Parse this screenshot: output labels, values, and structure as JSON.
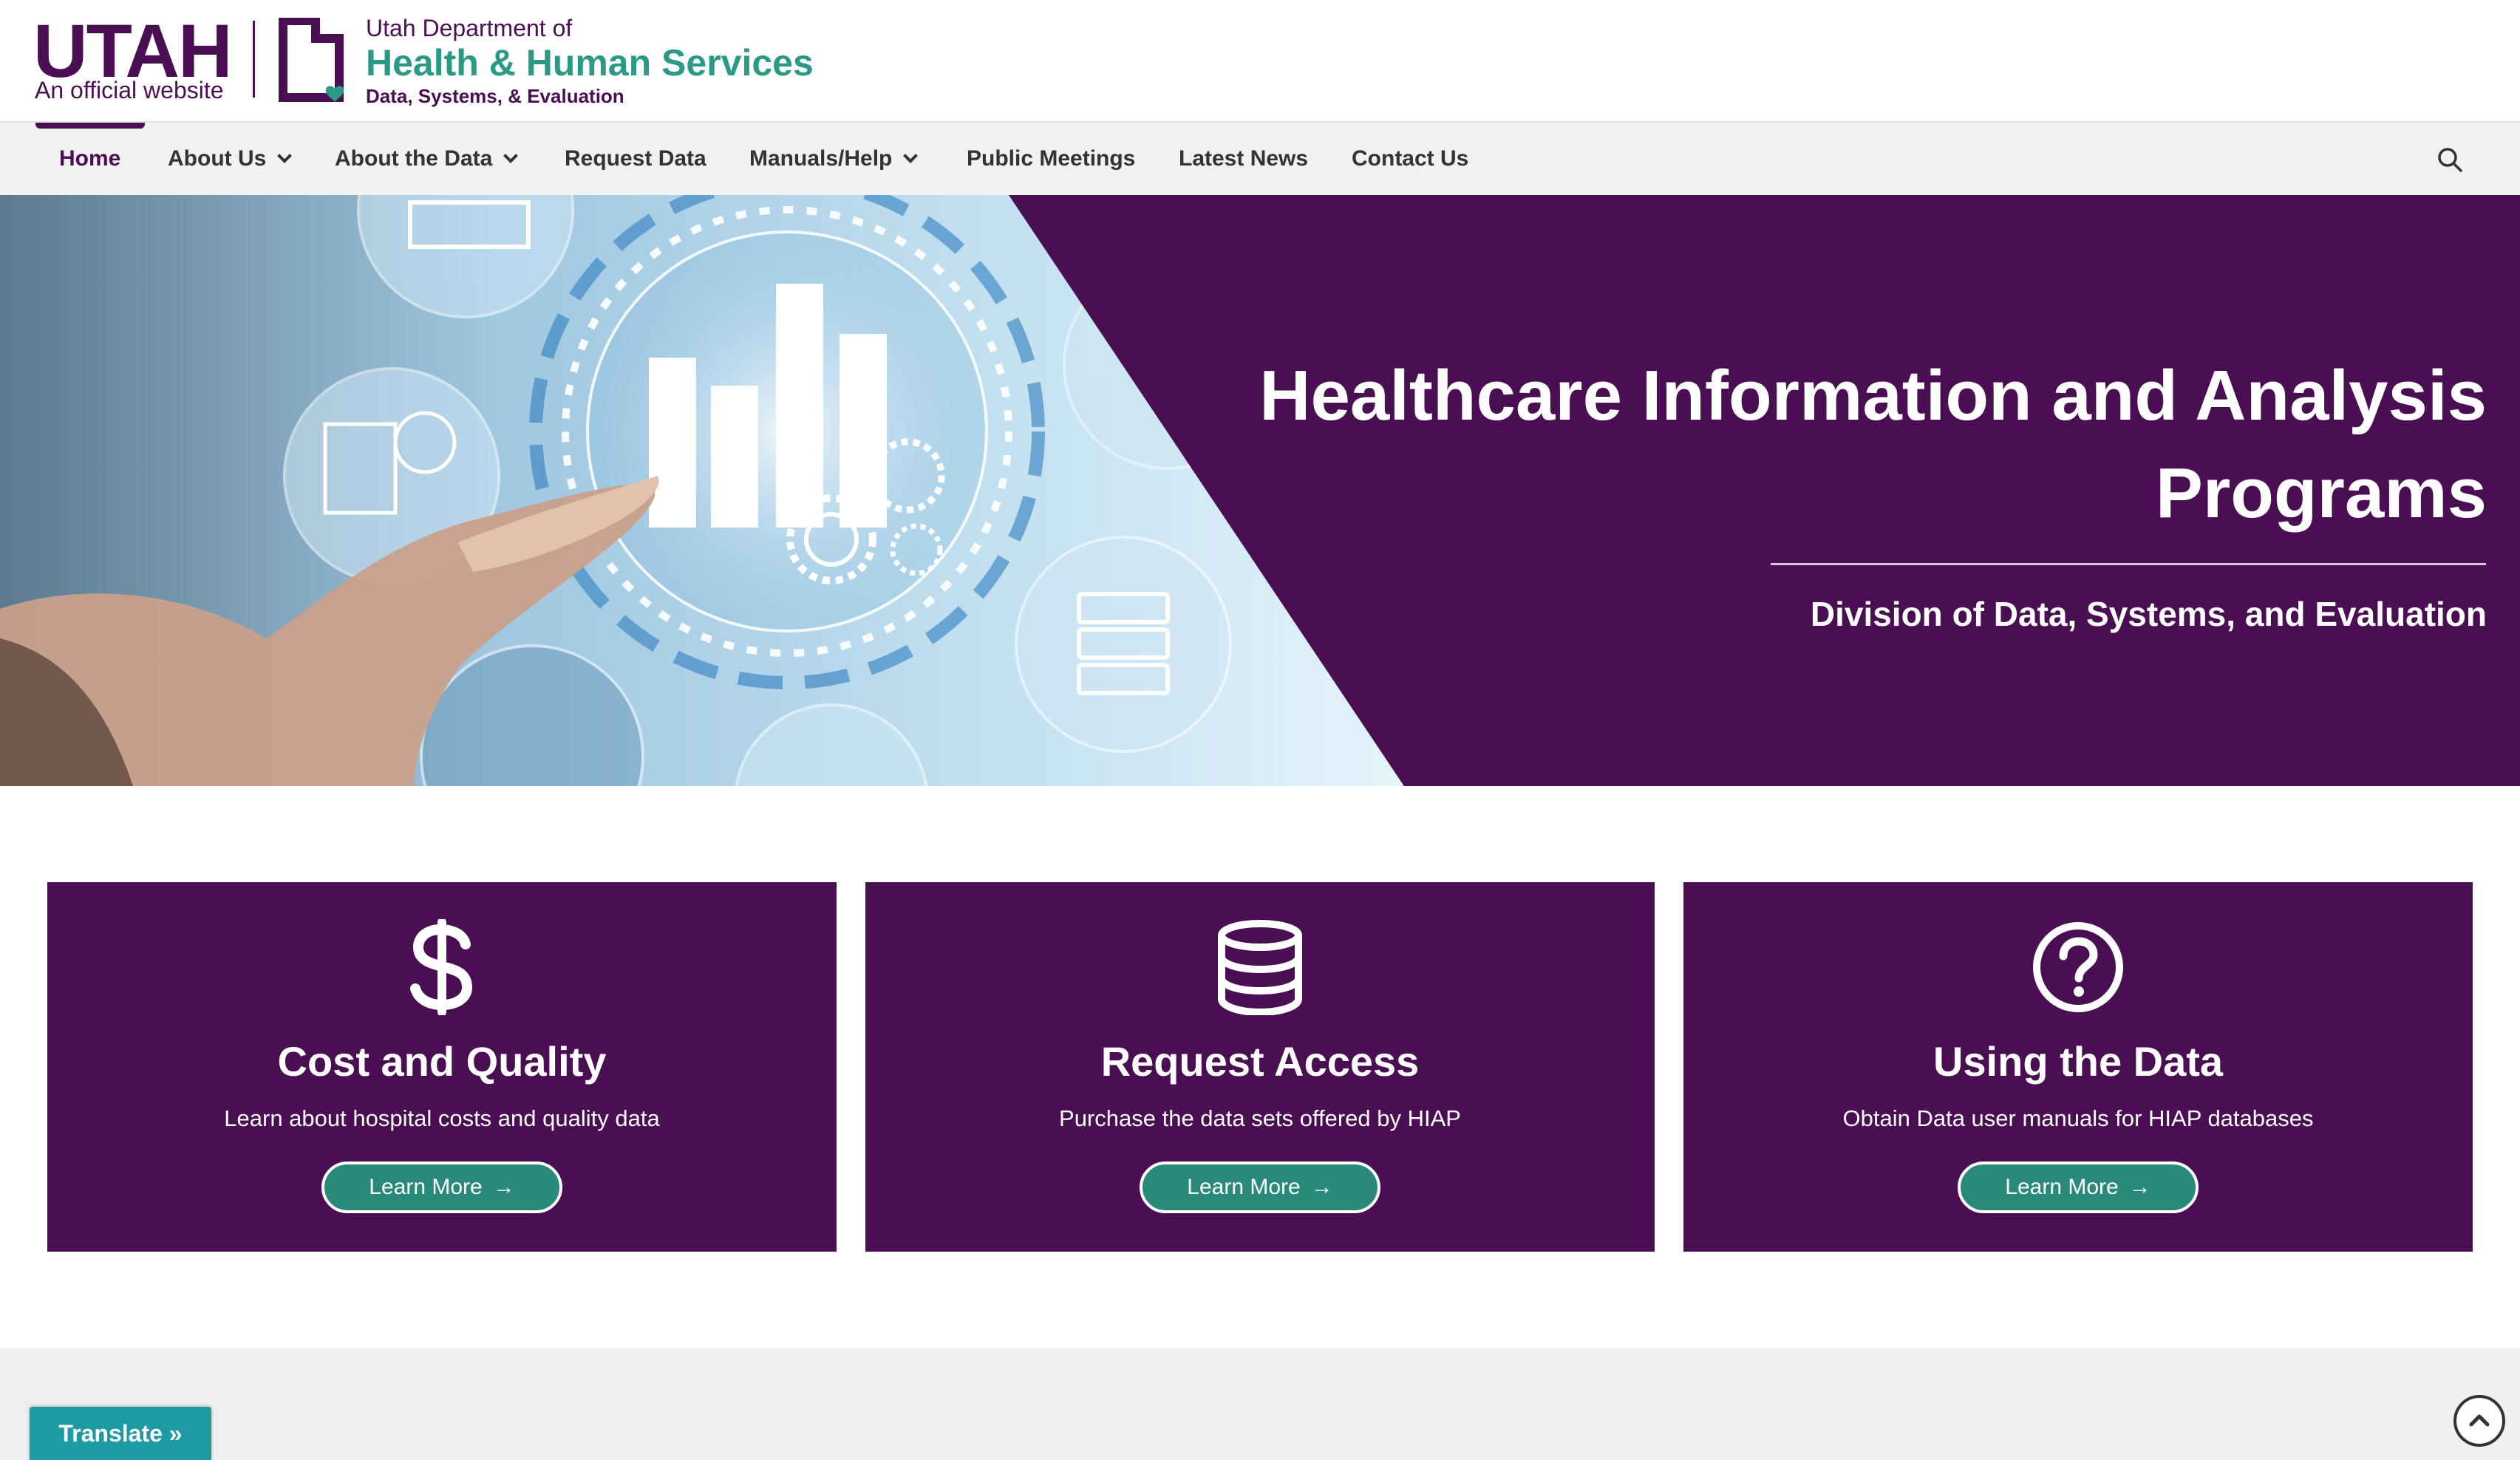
{
  "header": {
    "utah_wordmark": "UTAH",
    "utah_tagline": "An official website",
    "dept_line1": "Utah Department of",
    "dept_line2": "Health & Human Services",
    "dept_line3": "Data, Systems, & Evaluation"
  },
  "nav": {
    "items": [
      {
        "label": "Home",
        "has_dropdown": false,
        "active": true
      },
      {
        "label": "About Us",
        "has_dropdown": true
      },
      {
        "label": "About the Data",
        "has_dropdown": true
      },
      {
        "label": "Request Data",
        "has_dropdown": false
      },
      {
        "label": "Manuals/Help",
        "has_dropdown": true
      },
      {
        "label": "Public Meetings",
        "has_dropdown": false
      },
      {
        "label": "Latest News",
        "has_dropdown": false
      },
      {
        "label": "Contact Us",
        "has_dropdown": false
      }
    ],
    "search_icon": "search-icon"
  },
  "hero": {
    "title": "Healthcare Information and Analysis Programs",
    "subtitle": "Division of Data, Systems, and Evaluation"
  },
  "cards": [
    {
      "icon": "dollar-icon",
      "title": "Cost and Quality",
      "description": "Learn about hospital costs and quality data",
      "button": "Learn More"
    },
    {
      "icon": "database-icon",
      "title": "Request Access",
      "description": "Purchase the data sets offered by HIAP",
      "button": "Learn More"
    },
    {
      "icon": "question-circle-icon",
      "title": "Using the Data",
      "description": "Obtain Data user manuals for HIAP databases",
      "button": "Learn More"
    }
  ],
  "footer": {
    "translate_label": "Translate »",
    "scroll_top_icon": "chevron-up-icon"
  },
  "colors": {
    "brand_purple": "#4a0f52",
    "brand_teal": "#2a9985",
    "button_teal": "#2a8a7a",
    "translate_blue": "#1e9aa3"
  }
}
